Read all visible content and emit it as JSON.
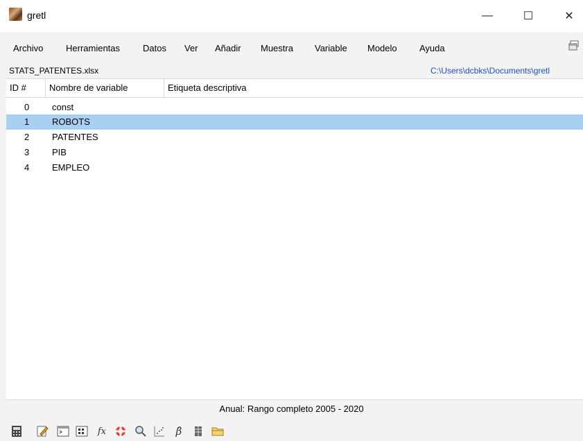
{
  "window": {
    "title": "gretl",
    "minimize": "—",
    "maximize": "☐",
    "close": "✕"
  },
  "menu": [
    "Archivo",
    "Herramientas",
    "Datos",
    "Ver",
    "Añadir",
    "Muestra",
    "Variable",
    "Modelo",
    "Ayuda"
  ],
  "file": {
    "name": "STATS_PATENTES.xlsx",
    "path": "C:\\Users\\dcbks\\Documents\\gretl"
  },
  "table": {
    "columns": [
      "ID #",
      "Nombre de variable",
      "Etiqueta descriptiva"
    ],
    "rows": [
      {
        "id": "0",
        "name": "const",
        "label": ""
      },
      {
        "id": "1",
        "name": "ROBOTS",
        "label": ""
      },
      {
        "id": "2",
        "name": "PATENTES",
        "label": ""
      },
      {
        "id": "3",
        "name": "PIB",
        "label": ""
      },
      {
        "id": "4",
        "name": "EMPLEO",
        "label": ""
      }
    ],
    "selected_id": "1"
  },
  "status": "Anual: Rango completo 2005 - 2020",
  "toolbar": [
    {
      "name": "calculator-icon"
    },
    {
      "name": "script-editor-icon"
    },
    {
      "name": "terminal-icon"
    },
    {
      "name": "session-icons-icon"
    },
    {
      "name": "function-icon",
      "glyph": "fx"
    },
    {
      "name": "help-lifebuoy-icon"
    },
    {
      "name": "search-icon"
    },
    {
      "name": "scatter-plot-icon"
    },
    {
      "name": "beta-hat-icon",
      "glyph": "β̂"
    },
    {
      "name": "database-icon"
    },
    {
      "name": "open-folder-icon"
    }
  ],
  "colors": {
    "selected_row": "#a9d0f2",
    "path_link": "#1a4ec8"
  }
}
